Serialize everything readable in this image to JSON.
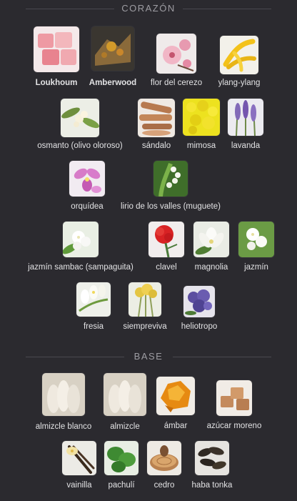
{
  "sections": {
    "heart": {
      "title": "CORAZÓN"
    },
    "base": {
      "title": "BASE"
    }
  },
  "notes": {
    "loukhoum": "Loukhoum",
    "amberwood": "Amberwood",
    "cherry_blossom": "flor del cerezo",
    "ylang_ylang": "ylang-ylang",
    "osmanthus": "osmanto (olivo oloroso)",
    "sandalwood": "sándalo",
    "mimosa": "mimosa",
    "lavender": "lavanda",
    "orchid": "orquídea",
    "lily_of_valley": "lirio de los valles (muguete)",
    "sambac_jasmine": "jazmín sambac (sampaguita)",
    "carnation": "clavel",
    "magnolia": "magnolia",
    "jasmine": "jazmín",
    "freesia": "fresia",
    "immortelle": "siempreviva",
    "heliotrope": "heliotropo",
    "white_musk": "almizcle blanco",
    "musk": "almizcle",
    "amber": "ámbar",
    "brown_sugar": "azúcar moreno",
    "vanilla": "vainilla",
    "patchouli": "pachulí",
    "cedar": "cedro",
    "tonka": "haba tonka"
  }
}
